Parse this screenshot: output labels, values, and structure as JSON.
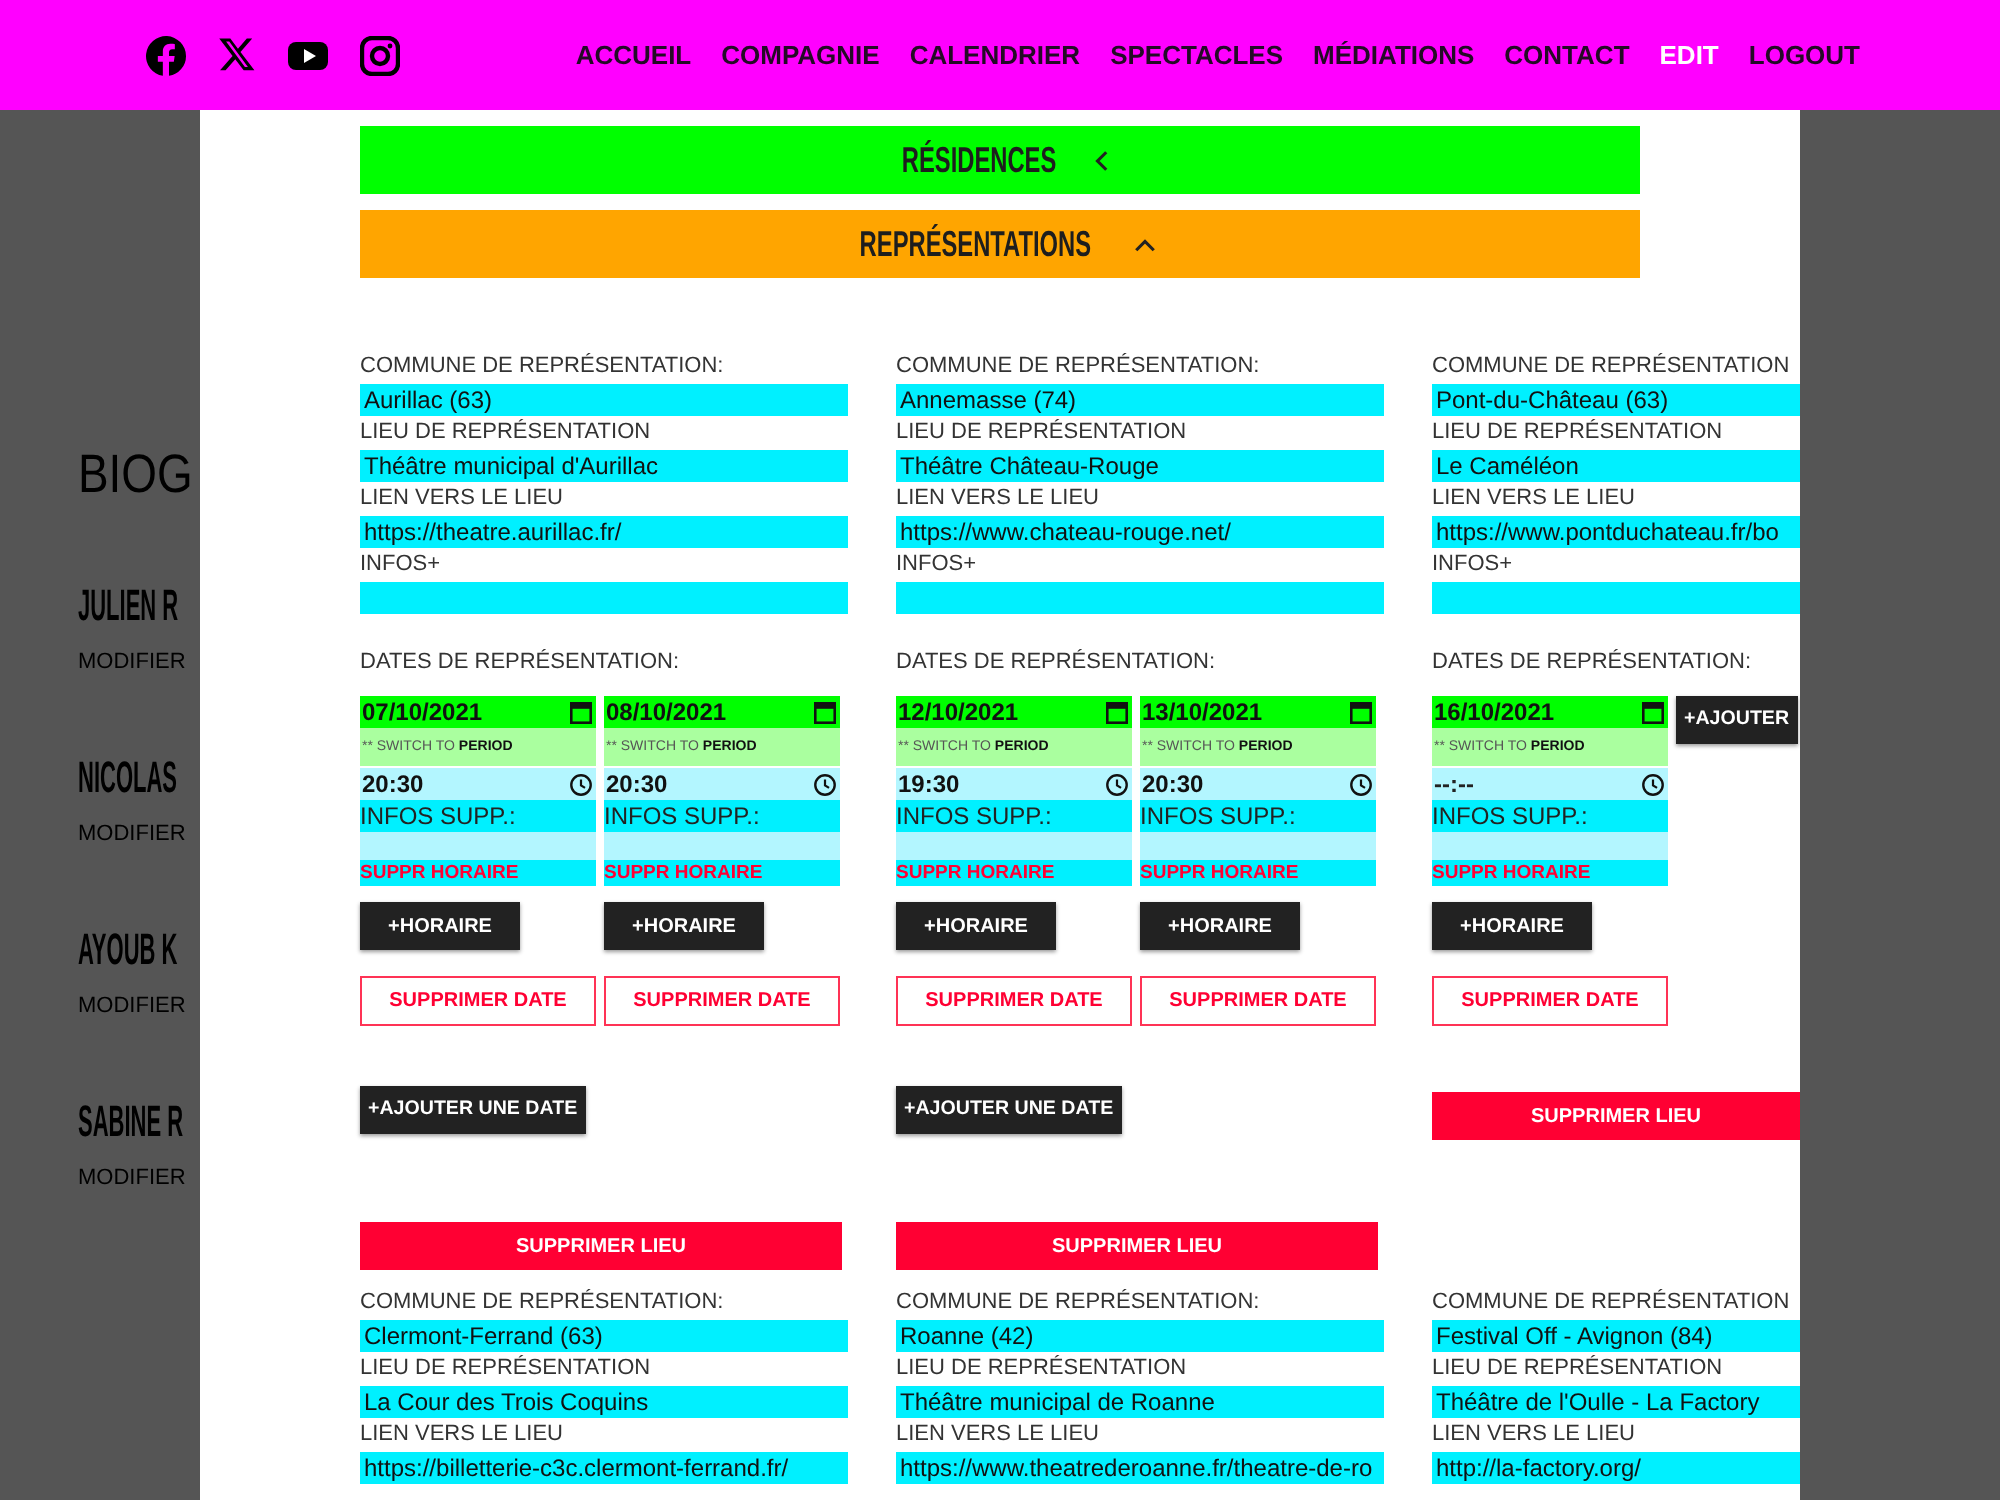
{
  "menu": [
    {
      "label": "ACCUEIL",
      "selected": false
    },
    {
      "label": "COMPAGNIE",
      "selected": false
    },
    {
      "label": "CALENDRIER",
      "selected": false
    },
    {
      "label": "SPECTACLES",
      "selected": false
    },
    {
      "label": "MÉDIATIONS",
      "selected": false
    },
    {
      "label": "CONTACT",
      "selected": false
    },
    {
      "label": "EDIT",
      "selected": true
    },
    {
      "label": "LOGOUT",
      "selected": false
    }
  ],
  "background_page": {
    "heading": "BIOG",
    "people": [
      {
        "name": "JULIEN R",
        "action": "MODIFIER"
      },
      {
        "name": "NICOLAS",
        "action": "MODIFIER"
      },
      {
        "name": "AYOUB K",
        "action": "MODIFIER"
      },
      {
        "name": "SABINE R",
        "action": "MODIFIER"
      }
    ]
  },
  "modal": {
    "sections": [
      {
        "title": "RÉSIDENCES",
        "color": "#00ff00",
        "expanded": false
      },
      {
        "title": "REPRÉSENTATIONS",
        "color": "#ffa500",
        "expanded": true
      }
    ],
    "venues": [
      {
        "fields": [
          {
            "label": "COMMUNE DE REPRÉSENTATION:",
            "value": "Aurillac (63)"
          },
          {
            "label": "LIEU DE REPRÉSENTATION",
            "value": "Théâtre municipal d'Aurillac"
          },
          {
            "label": "LIEN VERS LE LIEU",
            "value": "https://theatre.aurillac.fr/"
          },
          {
            "label": "INFOS+"
          }
        ],
        "dates_label": "DATES DE REPRÉSENTATION:",
        "dates": [
          {
            "date": "07/10/2021",
            "switch_label": "** SWITCH TO",
            "switch_link": "PERIOD",
            "times": [
              {
                "time": "20:30",
                "infos_label": "INFOS SUPP.:",
                "delete": "SUPPR HORAIRE"
              }
            ],
            "add_time": "+HORAIRE",
            "delete": "SUPPRIMER DATE"
          },
          {
            "date": "08/10/2021",
            "switch_label": "** SWITCH TO",
            "switch_link": "PERIOD",
            "times": [
              {
                "time": "20:30",
                "infos_label": "INFOS SUPP.:",
                "delete": "SUPPR HORAIRE"
              }
            ],
            "add_time": "+HORAIRE",
            "delete": "SUPPRIMER DATE"
          }
        ],
        "add_date": "+AJOUTER UNE DATE",
        "delete": "SUPPRIMER LIEU"
      },
      {
        "fields": [
          {
            "label": "COMMUNE DE REPRÉSENTATION:",
            "value": "Annemasse (74)"
          },
          {
            "label": "LIEU DE REPRÉSENTATION",
            "value": "Théâtre Château-Rouge"
          },
          {
            "label": "LIEN VERS LE LIEU",
            "value": "https://www.chateau-rouge.net/"
          },
          {
            "label": "INFOS+"
          }
        ],
        "dates_label": "DATES DE REPRÉSENTATION:",
        "dates": [
          {
            "date": "12/10/2021",
            "switch_label": "** SWITCH TO",
            "switch_link": "PERIOD",
            "times": [
              {
                "time": "19:30",
                "infos_label": "INFOS SUPP.:",
                "delete": "SUPPR HORAIRE"
              }
            ],
            "add_time": "+HORAIRE",
            "delete": "SUPPRIMER DATE"
          },
          {
            "date": "13/10/2021",
            "switch_label": "** SWITCH TO",
            "switch_link": "PERIOD",
            "times": [
              {
                "time": "20:30",
                "infos_label": "INFOS SUPP.:",
                "delete": "SUPPR HORAIRE"
              }
            ],
            "add_time": "+HORAIRE",
            "delete": "SUPPRIMER DATE"
          }
        ],
        "add_date": "+AJOUTER UNE DATE",
        "delete": "SUPPRIMER LIEU"
      },
      {
        "fields": [
          {
            "label": "COMMUNE DE REPRÉSENTATION",
            "value": "Pont-du-Château (63)"
          },
          {
            "label": "LIEU DE REPRÉSENTATION",
            "value": "Le Caméléon"
          },
          {
            "label": "LIEN VERS LE LIEU",
            "value": "https://www.pontduchateau.fr/bo"
          },
          {
            "label": "INFOS+"
          }
        ],
        "dates_label": "DATES DE REPRÉSENTATION:",
        "dates": [
          {
            "date": "16/10/2021",
            "switch_label": "** SWITCH TO",
            "switch_link": "PERIOD",
            "times": [
              {
                "placeholder": "--:--",
                "infos_label": "INFOS SUPP.:",
                "delete": "SUPPR HORAIRE"
              }
            ],
            "add_time": "+HORAIRE",
            "delete": "SUPPRIMER DATE"
          }
        ],
        "add_date": "+AJOUTER",
        "delete": "SUPPRIMER LIEU"
      },
      {
        "fields": [
          {
            "label": "COMMUNE DE REPRÉSENTATION:",
            "value": "Clermont-Ferrand (63)"
          },
          {
            "label": "LIEU DE REPRÉSENTATION",
            "value": "La Cour des Trois Coquins"
          },
          {
            "label": "LIEN VERS LE LIEU",
            "value": "https://billetterie-c3c.clermont-ferrand.fr/"
          }
        ]
      },
      {
        "fields": [
          {
            "label": "COMMUNE DE REPRÉSENTATION:",
            "value": "Roanne (42)"
          },
          {
            "label": "LIEU DE REPRÉSENTATION",
            "value": "Théâtre municipal de Roanne"
          },
          {
            "label": "LIEN VERS LE LIEU",
            "value": "https://www.theatrederoanne.fr/theatre-de-ro"
          }
        ]
      },
      {
        "fields": [
          {
            "label": "COMMUNE DE REPRÉSENTATION",
            "value": "Festival Off - Avignon (84)"
          },
          {
            "label": "LIEU DE REPRÉSENTATION",
            "value": "Théâtre de l'Oulle - La Factory"
          },
          {
            "label": "LIEN VERS LE LIEU",
            "value": "http://la-factory.org/"
          }
        ]
      }
    ]
  }
}
